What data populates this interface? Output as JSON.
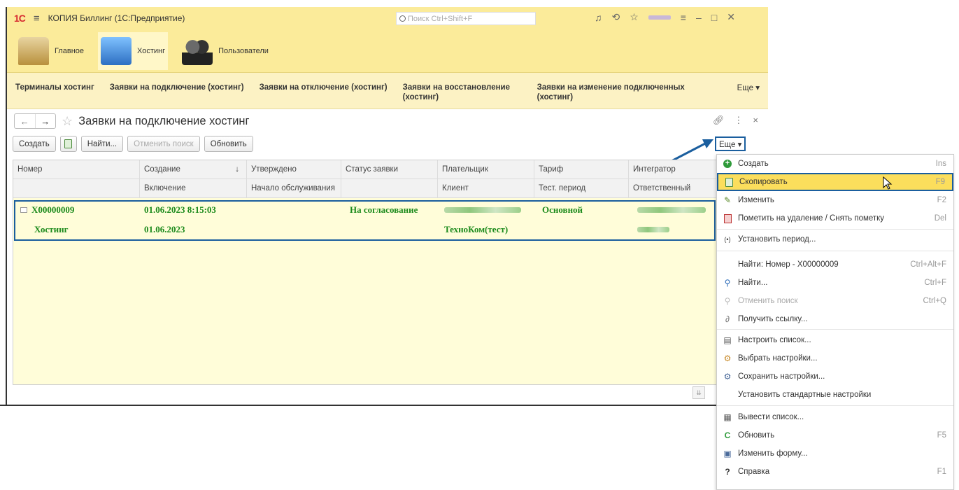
{
  "titlebar": {
    "logo": "1С",
    "app_title": "КОПИЯ Биллинг  (1С:Предприятие)",
    "search_placeholder": "Поиск Ctrl+Shift+F"
  },
  "sections": [
    {
      "label": "Главное",
      "icon": "home-desk-icon"
    },
    {
      "label": "Хостинг",
      "icon": "hosting-monitors-icon"
    },
    {
      "label": "Пользователи",
      "icon": "users-icon"
    }
  ],
  "subnav": {
    "items": [
      "Терминалы хостинг",
      "Заявки на подключение (хостинг)",
      "Заявки на отключение (хостинг)",
      "Заявки на восстановление (хостинг)",
      "Заявки на изменение подключенных (хостинг)"
    ],
    "more": "Еще ▾"
  },
  "form": {
    "title": "Заявки на подключение хостинг"
  },
  "toolbar": {
    "create": "Создать",
    "find": "Найти...",
    "cancel_search": "Отменить поиск",
    "refresh": "Обновить",
    "more": "Еще ▾"
  },
  "grid": {
    "header_row1": [
      "Номер",
      "Создание",
      "Утверждено",
      "Статус заявки",
      "Плательщик",
      "Тариф",
      "Интегратор"
    ],
    "header_row2": [
      "",
      "Включение",
      "Начало обслуживания",
      "",
      "Клиент",
      "Тест. период",
      "Ответственный"
    ],
    "sort_indicator": "↓",
    "rows": [
      {
        "number": "Х00000009",
        "created": "01.06.2023 8:15:03",
        "approved": "",
        "status": "На согласование",
        "tariff": "Основной",
        "subtype": "Хостинг",
        "enabled": "01.06.2023",
        "client": "ТехноКом(тест)"
      }
    ]
  },
  "menu": {
    "items": [
      {
        "label": "Создать",
        "shortcut": "Ins",
        "icon": "plus-circle-icon"
      },
      {
        "label": "Скопировать",
        "shortcut": "F9",
        "icon": "copy-icon",
        "highlighted": true
      },
      {
        "label": "Изменить",
        "shortcut": "F2",
        "icon": "pencil-icon"
      },
      {
        "label": "Пометить на удаление / Снять пометку",
        "shortcut": "Del",
        "icon": "delete-mark-icon"
      },
      {
        "label": "Установить период...",
        "shortcut": "",
        "icon": "period-icon"
      },
      {
        "label": "Найти: Номер - Х00000009",
        "shortcut": "Ctrl+Alt+F",
        "icon": ""
      },
      {
        "label": "Найти...",
        "shortcut": "Ctrl+F",
        "icon": "find-icon"
      },
      {
        "label": "Отменить поиск",
        "shortcut": "Ctrl+Q",
        "icon": "cancel-find-icon",
        "disabled": true
      },
      {
        "label": "Получить ссылку...",
        "shortcut": "",
        "icon": "link-icon"
      },
      {
        "label": "Настроить список...",
        "shortcut": "",
        "icon": "configure-list-icon"
      },
      {
        "label": "Выбрать настройки...",
        "shortcut": "",
        "icon": "choose-settings-icon"
      },
      {
        "label": "Сохранить настройки...",
        "shortcut": "",
        "icon": "save-settings-icon"
      },
      {
        "label": "Установить стандартные настройки",
        "shortcut": "",
        "icon": ""
      },
      {
        "label": "Вывести список...",
        "shortcut": "",
        "icon": "output-list-icon"
      },
      {
        "label": "Обновить",
        "shortcut": "F5",
        "icon": "refresh-icon"
      },
      {
        "label": "Изменить форму...",
        "shortcut": "",
        "icon": "change-form-icon"
      },
      {
        "label": "Справка",
        "shortcut": "F1",
        "icon": "help-icon"
      }
    ]
  }
}
